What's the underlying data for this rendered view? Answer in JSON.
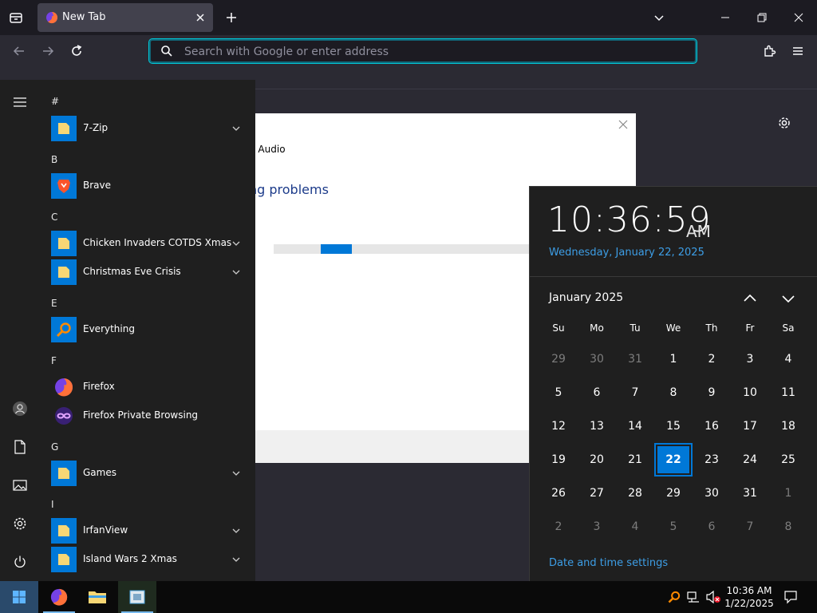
{
  "browser": {
    "tab_title": "New Tab",
    "url_placeholder": "Search with Google or enter address"
  },
  "dialog": {
    "line1": "g Audio",
    "line2": "ng problems"
  },
  "start_menu": {
    "groups": [
      {
        "letter": "#",
        "apps": [
          {
            "name": "7-Zip",
            "icon": "folder-icon",
            "expandable": true
          }
        ]
      },
      {
        "letter": "B",
        "apps": [
          {
            "name": "Brave",
            "icon": "brave-icon",
            "expandable": false
          }
        ]
      },
      {
        "letter": "C",
        "apps": [
          {
            "name": "Chicken Invaders COTDS Xmas",
            "icon": "folder-icon",
            "expandable": true
          },
          {
            "name": "Christmas Eve Crisis",
            "icon": "folder-icon",
            "expandable": true
          }
        ]
      },
      {
        "letter": "E",
        "apps": [
          {
            "name": "Everything",
            "icon": "search-icon",
            "expandable": false
          }
        ]
      },
      {
        "letter": "F",
        "apps": [
          {
            "name": "Firefox",
            "icon": "firefox-icon",
            "expandable": false
          },
          {
            "name": "Firefox Private Browsing",
            "icon": "private-browsing-icon",
            "expandable": false
          }
        ]
      },
      {
        "letter": "G",
        "apps": [
          {
            "name": "Games",
            "icon": "folder-icon",
            "expandable": true
          }
        ]
      },
      {
        "letter": "I",
        "apps": [
          {
            "name": "IrfanView",
            "icon": "folder-icon",
            "expandable": true
          },
          {
            "name": "Island Wars 2 Xmas",
            "icon": "folder-icon",
            "expandable": true
          }
        ]
      }
    ]
  },
  "clock": {
    "time": "10:36:59",
    "ampm": "AM",
    "date": "Wednesday, January 22, 2025",
    "month": "January 2025",
    "weekdays": [
      "Su",
      "Mo",
      "Tu",
      "We",
      "Th",
      "Fr",
      "Sa"
    ],
    "weeks": [
      [
        "29",
        "30",
        "31",
        "1",
        "2",
        "3",
        "4"
      ],
      [
        "5",
        "6",
        "7",
        "8",
        "9",
        "10",
        "11"
      ],
      [
        "12",
        "13",
        "14",
        "15",
        "16",
        "17",
        "18"
      ],
      [
        "19",
        "20",
        "21",
        "22",
        "23",
        "24",
        "25"
      ],
      [
        "26",
        "27",
        "28",
        "29",
        "30",
        "31",
        "1"
      ],
      [
        "2",
        "3",
        "4",
        "5",
        "6",
        "7",
        "8"
      ]
    ],
    "today": "22",
    "settings_link": "Date and time settings"
  },
  "taskbar": {
    "time": "10:36 AM",
    "date": "1/22/2025"
  },
  "colors": {
    "accent": "#0078d7",
    "link": "#3d9ee6"
  }
}
